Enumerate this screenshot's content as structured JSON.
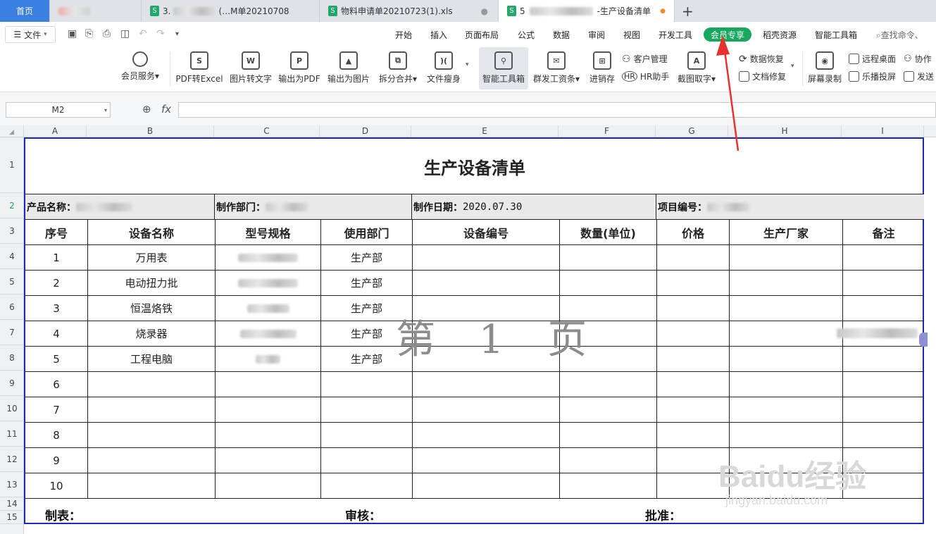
{
  "tabs": [
    {
      "label": "首页"
    },
    {
      "label": "3.",
      "suffix": "(…M单20210708"
    },
    {
      "label": "物料申请单20210723(1).xls"
    },
    {
      "label": "5",
      "suffix": "-生产设备清单"
    }
  ],
  "file_menu": "文件",
  "menus": [
    "开始",
    "插入",
    "页面布局",
    "公式",
    "数据",
    "审阅",
    "视图",
    "开发工具",
    "会员专享",
    "稻壳资源",
    "智能工具箱"
  ],
  "search_placeholder": "查找命令、",
  "ribbon": {
    "member_service": "会员服务",
    "pdf_excel": "PDF转Excel",
    "img_text": "图片转文字",
    "out_pdf": "输出为PDF",
    "out_img": "输出为图片",
    "split_merge": "拆分合并",
    "slim": "文件瘦身",
    "smart_tools": "智能工具箱",
    "mass_salary": "群发工资条",
    "inventory": "进销存",
    "crm": "客户管理",
    "hr": "HR助手",
    "screenshot_text": "截图取字",
    "data_recover": "数据恢复",
    "doc_repair": "文档修复",
    "screen_rec": "屏幕录制",
    "remote": "远程桌面",
    "cast": "乐播投屏",
    "collab": "协作",
    "send": "发送"
  },
  "name_box": "M2",
  "fx": "fx",
  "columns": [
    "A",
    "B",
    "C",
    "D",
    "E",
    "F",
    "G",
    "H",
    "I"
  ],
  "rows": [
    "1",
    "2",
    "3",
    "4",
    "5",
    "6",
    "7",
    "8",
    "9",
    "10",
    "11",
    "12",
    "13",
    "14",
    "15"
  ],
  "sheet": {
    "title": "生产设备清单",
    "product_label": "产品名称：",
    "dept_label": "制作部门：",
    "date_label": "制作日期：",
    "date_value": "2020.07.30",
    "project_label": "项目编号：",
    "headers": [
      "序号",
      "设备名称",
      "型号规格",
      "使用部门",
      "设备编号",
      "数量(单位)",
      "价格",
      "生产厂家",
      "备注"
    ],
    "items": [
      {
        "no": "1",
        "name": "万用表",
        "dept": "生产部"
      },
      {
        "no": "2",
        "name": "电动扭力批",
        "dept": "生产部"
      },
      {
        "no": "3",
        "name": "恒温烙铁",
        "dept": "生产部"
      },
      {
        "no": "4",
        "name": "烧录器",
        "dept": "生产部"
      },
      {
        "no": "5",
        "name": "工程电脑",
        "dept": "生产部"
      },
      {
        "no": "6",
        "name": "",
        "dept": ""
      },
      {
        "no": "7",
        "name": "",
        "dept": ""
      },
      {
        "no": "8",
        "name": "",
        "dept": ""
      },
      {
        "no": "9",
        "name": "",
        "dept": ""
      },
      {
        "no": "10",
        "name": "",
        "dept": ""
      }
    ],
    "footer_maker": "制表：",
    "footer_review": "审核：",
    "footer_approve": "批准：",
    "page_watermark": "第 1 页"
  },
  "watermark_brand": "Baidu经验",
  "watermark_url": "jingyan.baidu.com",
  "colors": {
    "vip": "#17a85d",
    "home_tab": "#3b7fe0",
    "sheet_border": "#1f2ab3",
    "arrow": "#e8312f"
  }
}
